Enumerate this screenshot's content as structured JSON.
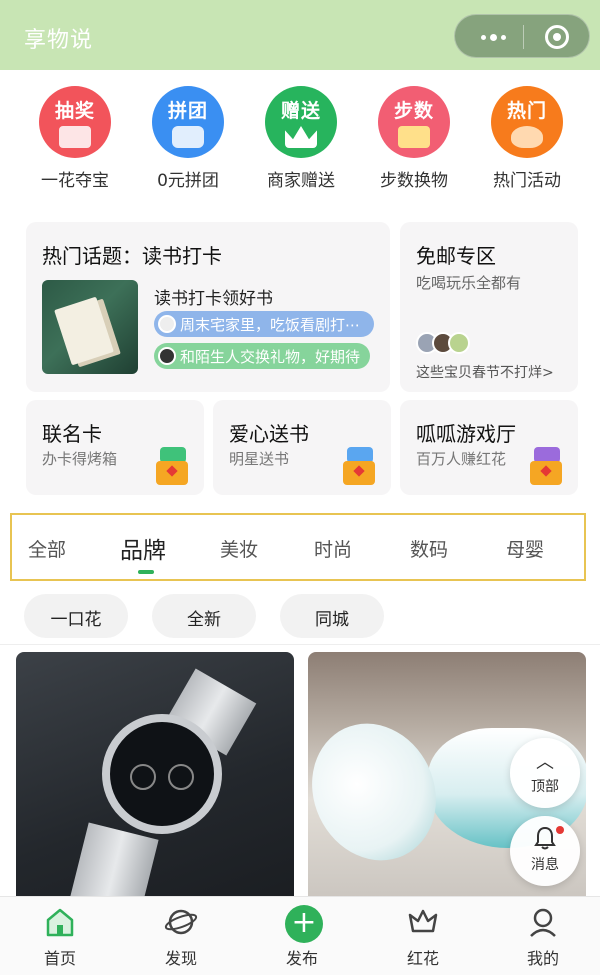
{
  "header": {
    "title": "享物说"
  },
  "quick_actions": [
    {
      "badge": "抽奖",
      "label": "一花夺宝",
      "color": "#f2545b"
    },
    {
      "badge": "拼团",
      "label": "0元拼团",
      "color": "#3a8ff2"
    },
    {
      "badge": "赠送",
      "label": "商家赠送",
      "color": "#27b45d"
    },
    {
      "badge": "步数",
      "label": "步数换物",
      "color": "#f25e73"
    },
    {
      "badge": "热门",
      "label": "热门活动",
      "color": "#f77b1c"
    }
  ],
  "topic_card": {
    "title": "热门话题：读书打卡",
    "subtitle": "读书打卡领好书",
    "pills": [
      "周末宅家里，吃饭看剧打⋯",
      "和陌生人交换礼物，好期待"
    ]
  },
  "free_shipping": {
    "title": "免邮专区",
    "subtitle": "吃喝玩乐全都有",
    "footer": "这些宝贝春节不打烊>"
  },
  "feature_cards": [
    {
      "title": "联名卡",
      "subtitle": "办卡得烤箱"
    },
    {
      "title": "爱心送书",
      "subtitle": "明星送书"
    },
    {
      "title": "呱呱游戏厅",
      "subtitle": "百万人赚红花"
    }
  ],
  "tabs": [
    "全部",
    "品牌",
    "美妆",
    "时尚",
    "数码",
    "母婴"
  ],
  "active_tab": "品牌",
  "filters": [
    "一口花",
    "全新",
    "同城"
  ],
  "floating": {
    "top_label": "顶部",
    "message_label": "消息"
  },
  "bottom_nav": [
    "首页",
    "发现",
    "发布",
    "红花",
    "我的"
  ],
  "colors": {
    "brand_green": "#2fb15a",
    "header_bg": "#c8e5b4",
    "tab_border": "#e8c452"
  }
}
